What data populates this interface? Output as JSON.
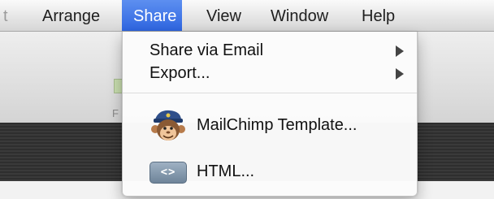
{
  "menubar": {
    "items": [
      {
        "label": "t"
      },
      {
        "label": "Arrange"
      },
      {
        "label": "Share"
      },
      {
        "label": "View"
      },
      {
        "label": "Window"
      },
      {
        "label": "Help"
      }
    ]
  },
  "background": {
    "partial_label": "F"
  },
  "share_menu": {
    "items": [
      {
        "label": "Share via Email",
        "submenu": true
      },
      {
        "label": "Export...",
        "submenu": true
      },
      {
        "label": "MailChimp Template...",
        "icon": "mailchimp-monkey-icon"
      },
      {
        "label": "HTML...",
        "icon": "html-code-icon",
        "icon_text": "<>"
      }
    ]
  },
  "colors": {
    "selected_menu": "#3d74e8",
    "menu_text": "#111111"
  }
}
